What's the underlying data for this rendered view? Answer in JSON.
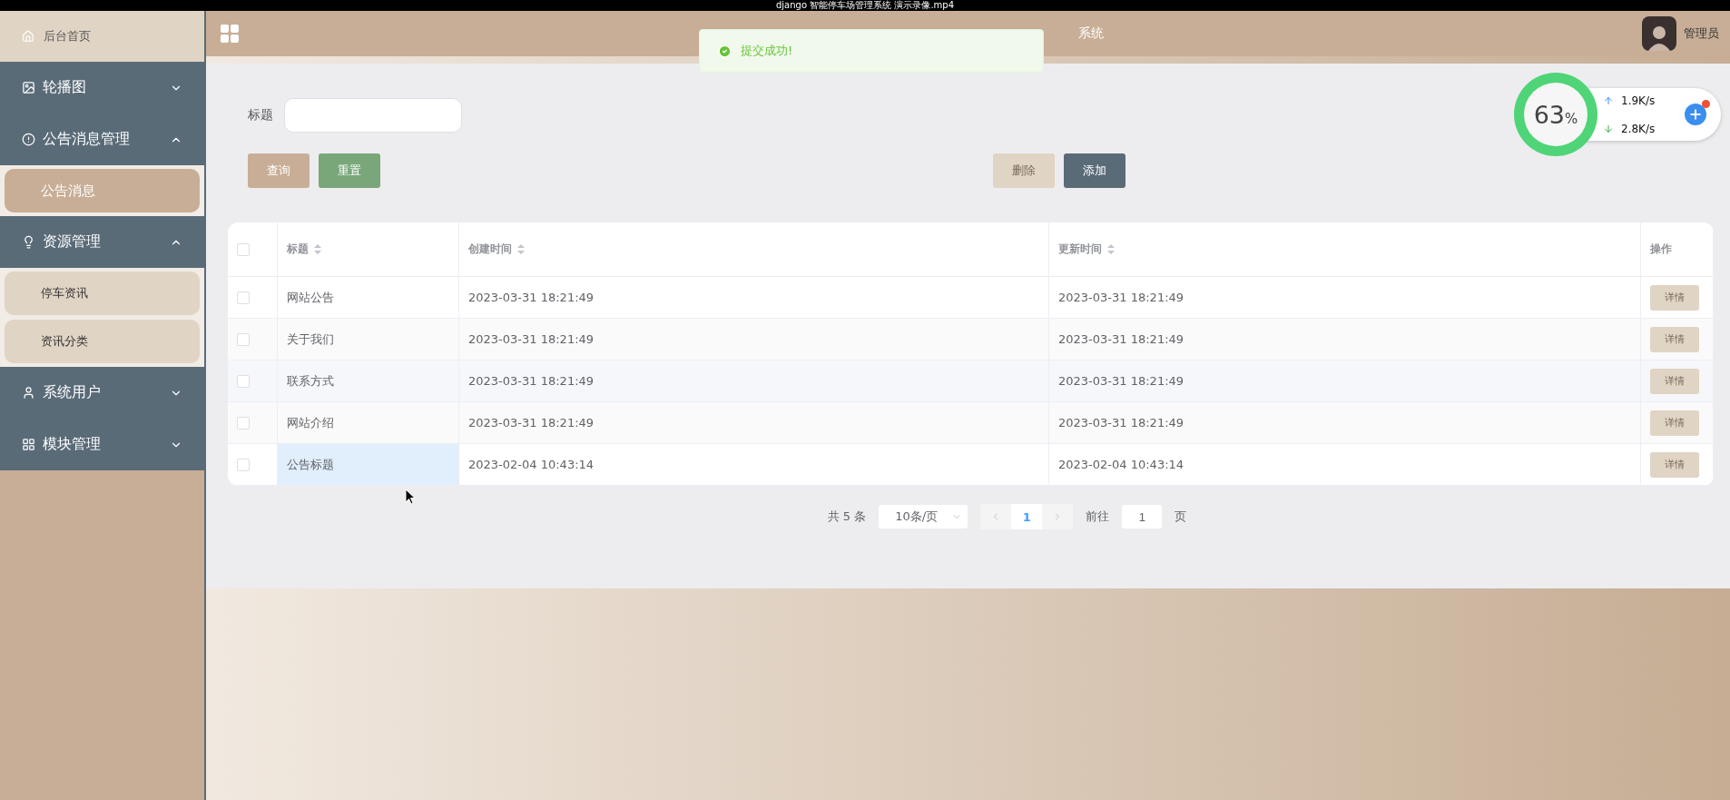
{
  "video_title": "django 智能停车场管理系统 演示录像.mp4",
  "header": {
    "home": "后台首页",
    "title": "系统",
    "user": "管理员"
  },
  "toast": {
    "text": "提交成功!"
  },
  "sidebar": {
    "items": [
      {
        "label": "轮播图",
        "expanded": false
      },
      {
        "label": "公告消息管理",
        "expanded": true,
        "children": [
          {
            "label": "公告消息",
            "selected": true
          }
        ]
      },
      {
        "label": "资源管理",
        "expanded": true,
        "children": [
          {
            "label": "停车资讯",
            "selected": false
          },
          {
            "label": "资讯分类",
            "selected": false
          }
        ]
      },
      {
        "label": "系统用户",
        "expanded": false
      },
      {
        "label": "模块管理",
        "expanded": false
      }
    ]
  },
  "filter": {
    "label": "标题",
    "buttons": [
      {
        "label": "查询",
        "kind": "query"
      },
      {
        "label": "重置",
        "kind": "reset"
      }
    ],
    "actions": [
      {
        "label": "删除",
        "kind": "delete",
        "disabled": true
      },
      {
        "label": "添加",
        "kind": "add",
        "disabled": false
      }
    ]
  },
  "table": {
    "select_all_checked": false,
    "columns": [
      "标题",
      "创建时间",
      "更新时间",
      "操作"
    ],
    "rows": [
      {
        "title": "网站公告",
        "created": "2023-03-31 18:21:49",
        "updated": "2023-03-31 18:21:49",
        "action": "详情",
        "checked": false,
        "hovered": false
      },
      {
        "title": "关于我们",
        "created": "2023-03-31 18:21:49",
        "updated": "2023-03-31 18:21:49",
        "action": "详情",
        "checked": false,
        "hovered": false
      },
      {
        "title": "联系方式",
        "created": "2023-03-31 18:21:49",
        "updated": "2023-03-31 18:21:49",
        "action": "详情",
        "checked": false,
        "hovered": false
      },
      {
        "title": "网站介绍",
        "created": "2023-03-31 18:21:49",
        "updated": "2023-03-31 18:21:49",
        "action": "详情",
        "checked": false,
        "hovered": false
      },
      {
        "title": "公告标题",
        "created": "2023-02-04 10:43:14",
        "updated": "2023-02-04 10:43:14",
        "action": "详情",
        "checked": false,
        "hovered": true
      }
    ]
  },
  "pagination": {
    "total": "共 5 条",
    "page_size": "10条/页",
    "pages": [
      {
        "label": "1",
        "selected": true
      }
    ],
    "goto_label": "前往",
    "goto_value": "1",
    "goto_suffix": "页"
  },
  "net_widget": {
    "percent": "63",
    "unit": "%",
    "up": "1.9K/s",
    "down": "2.8K/s"
  }
}
